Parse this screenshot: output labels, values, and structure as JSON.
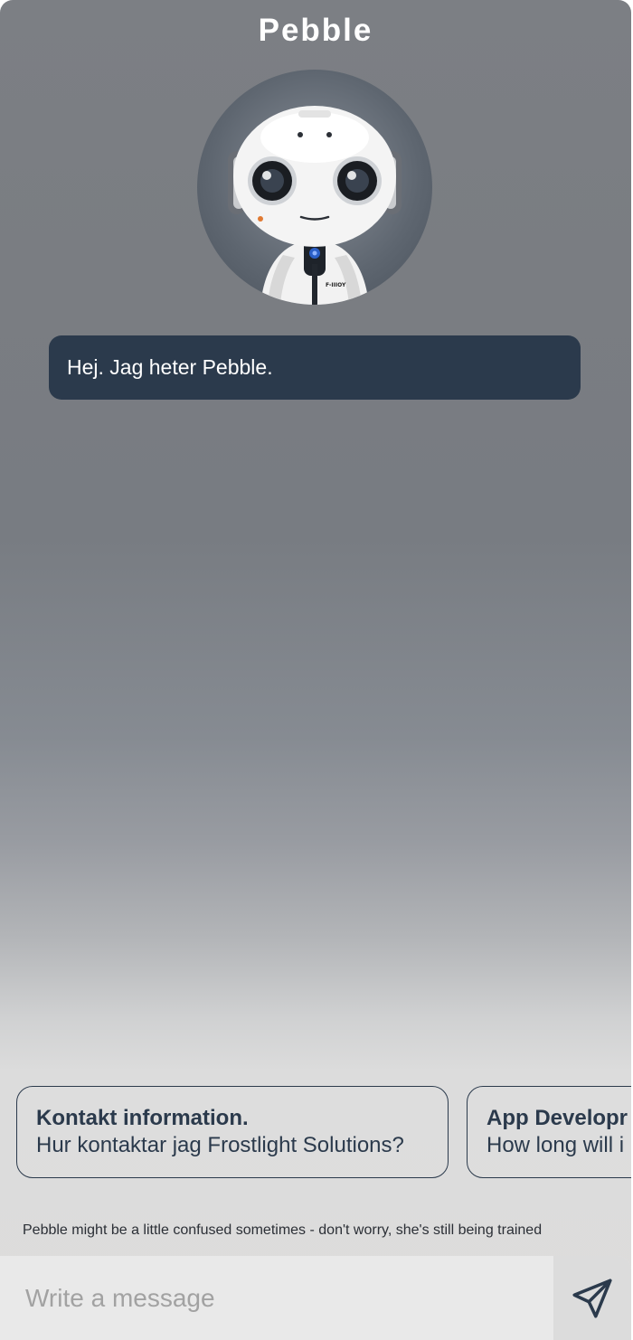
{
  "header": {
    "title": "Pebble"
  },
  "avatar": {
    "name": "robot-avatar",
    "badge_text": "F-IIIOY"
  },
  "messages": [
    {
      "sender": "bot",
      "text": "Hej. Jag heter Pebble."
    }
  ],
  "suggestions": [
    {
      "title": "Kontakt information.",
      "subtitle": "Hur kontaktar jag Frostlight Solutions?"
    },
    {
      "title": "App Developr",
      "subtitle": "How long will i"
    }
  ],
  "footer": {
    "disclaimer": "Pebble might be a little confused sometimes - don't worry, she's still being trained"
  },
  "composer": {
    "placeholder": "Write a message",
    "value": "",
    "send_icon": "send-paper-plane-icon"
  },
  "colors": {
    "bubble_bg": "#2b3a4c",
    "title_text": "#ffffff",
    "chip_border": "#2b3a4c"
  }
}
